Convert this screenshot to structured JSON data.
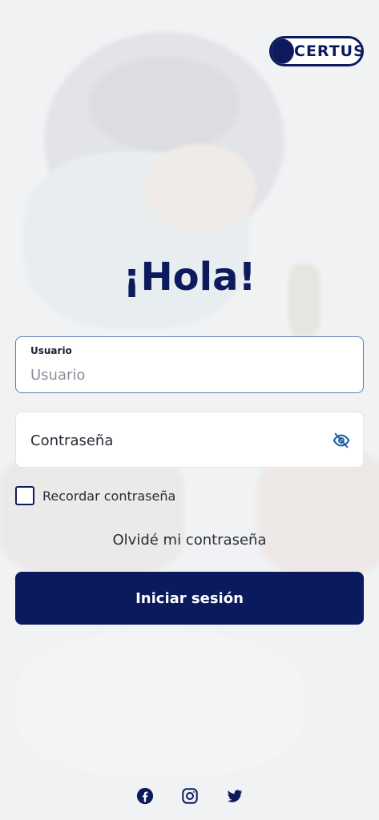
{
  "brand": {
    "logo_text": "CERTUS",
    "color": "#0d1b5e"
  },
  "greeting": "¡Hola!",
  "form": {
    "username": {
      "label": "Usuario",
      "placeholder": "Usuario",
      "value": ""
    },
    "password": {
      "placeholder": "Contraseña",
      "value": "",
      "toggle_icon": "eye-off-icon"
    },
    "remember": {
      "label": "Recordar contraseña",
      "checked": false
    },
    "forgot_link": "Olvidé mi contraseña",
    "submit_label": "Iniciar sesión"
  },
  "social": [
    {
      "name": "facebook-icon"
    },
    {
      "name": "instagram-icon"
    },
    {
      "name": "twitter-icon"
    }
  ],
  "colors": {
    "primary": "#0a1a5c",
    "accent_icon": "#1a5fa8",
    "focus_border": "#5b7fb8"
  }
}
